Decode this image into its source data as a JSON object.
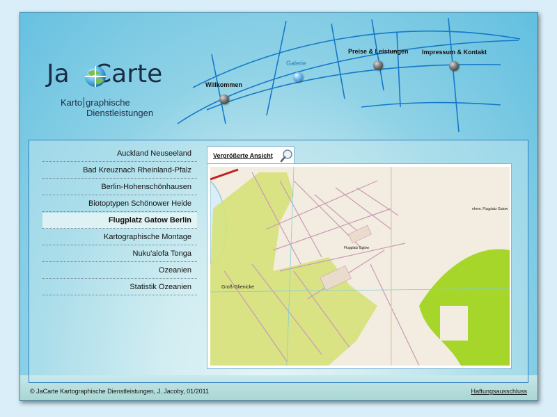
{
  "logo": {
    "text_ja": "Ja",
    "text_carte": "Carte",
    "sub_line1_a": "Karto",
    "sub_line1_b": "graphische",
    "sub_line2": "Dienstleistungen"
  },
  "nav": {
    "items": [
      {
        "label": "Willkommen"
      },
      {
        "label": "Galerie",
        "active": true
      },
      {
        "label": "Preise & Leistungen"
      },
      {
        "label": "Impressum & Kontakt"
      }
    ]
  },
  "gallery": {
    "items": [
      {
        "label": "Auckland Neuseeland"
      },
      {
        "label": "Bad Kreuznach Rheinland-Pfalz"
      },
      {
        "label": "Berlin-Hohenschönhausen"
      },
      {
        "label": "Biotoptypen Schönower Heide"
      },
      {
        "label": "Flugplatz Gatow Berlin",
        "active": true
      },
      {
        "label": "Kartographische Montage"
      },
      {
        "label": "Nuku'alofa Tonga"
      },
      {
        "label": "Ozeanien"
      },
      {
        "label": "Statistik Ozeanien"
      }
    ],
    "tab_label": "Vergrößerte Ansicht",
    "map_labels": {
      "place": "Groß-Glienicke",
      "airfield": "Flugplatz Gatow",
      "east": "ehem. Flugplatz Gatow"
    }
  },
  "footer": {
    "copyright": "© JaCarte Kartographische Dienstleistungen, J. Jacoby, 01/2011",
    "disclaimer": "Haftungsausschluss"
  },
  "colors": {
    "accent": "#2a7fc1",
    "frame_border": "#4a7e96",
    "map_green": "#c8dc5a",
    "map_bright_green": "#a6d62a"
  }
}
